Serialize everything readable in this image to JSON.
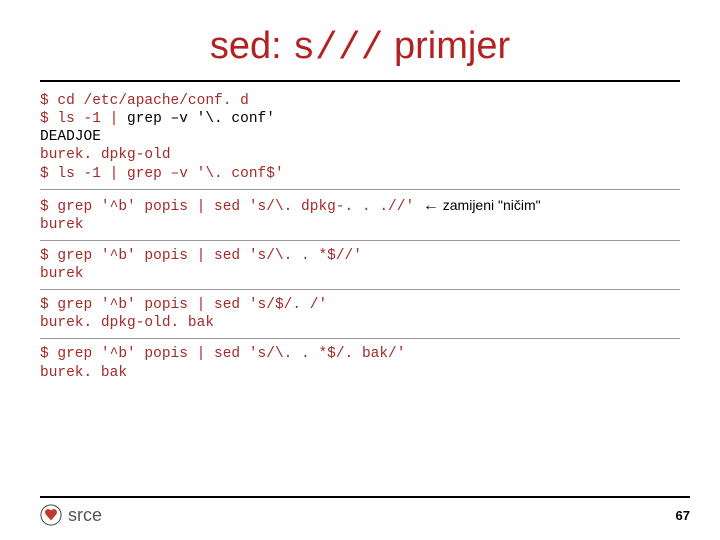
{
  "title_plain": "sed: ",
  "title_mono": "s///",
  "title_rest": " primjer",
  "block1_l1": "$ cd /etc/apache/conf. d",
  "block1_l2a": "$ ls -1 | ",
  "block1_l2b": "grep –v '\\. conf'",
  "block1_l3": "DEADJOE",
  "block1_l4": "burek. dpkg-old",
  "block1_l5": "$ ls -1 | grep –v '\\. conf$'",
  "block2_l1": "$ grep '^b' popis | sed 's/\\. dpkg-. . .//' ",
  "block2_arrow": "←",
  "block2_annot": " zamijeni \"ničim\"",
  "block2_l2": "burek",
  "block3_l1": "$ grep '^b' popis | sed 's/\\. . *$//'",
  "block3_l2": "burek",
  "block4_l1": "$ grep '^b' popis | sed 's/$/. /'",
  "block4_l2": "burek. dpkg-old. bak",
  "block5_l1": "$ grep '^b' popis | sed 's/\\. . *$/. bak/'",
  "block5_l2": "burek. bak",
  "brand": "srce",
  "page_number": "67"
}
